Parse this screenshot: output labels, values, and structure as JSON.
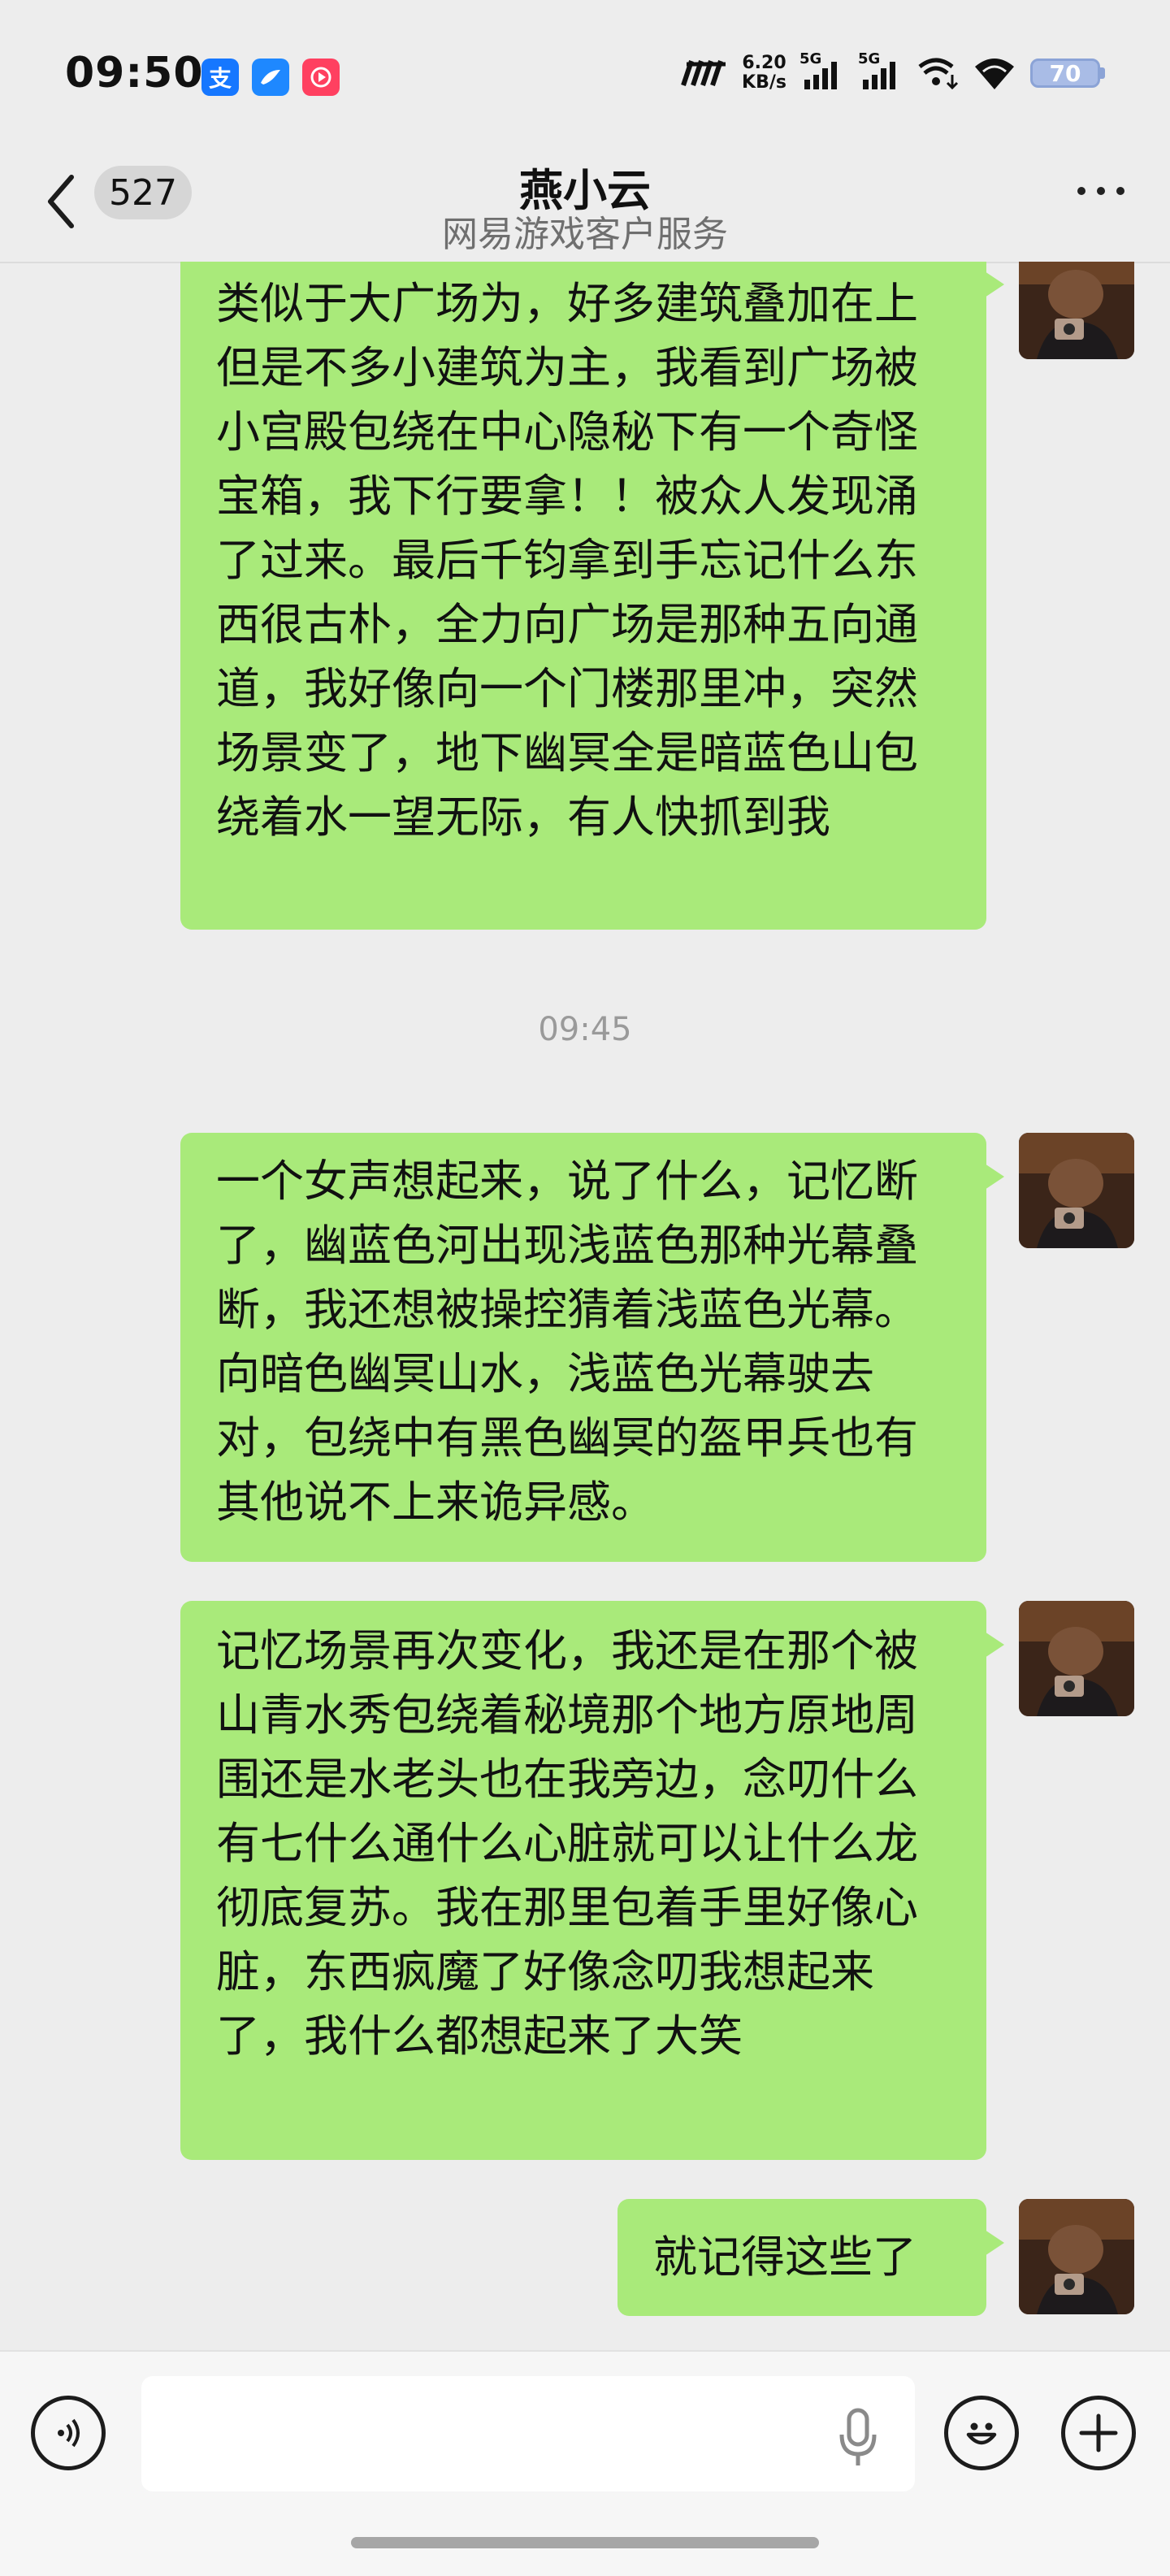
{
  "status_bar": {
    "time": "09:50",
    "net_speed_value": "6.20",
    "net_speed_unit": "KB/s",
    "signal1_label": "5G",
    "signal2_label": "5G",
    "battery_level": "70",
    "app_icons": [
      "alipay-icon",
      "bird-app-icon",
      "video-app-icon"
    ],
    "colors": {
      "alipay": "#1677ff",
      "bird": "#1e88ff",
      "video": "#ff4060"
    }
  },
  "header": {
    "unread_count": "527",
    "title": "燕小云",
    "subtitle": "网易游戏客户服务"
  },
  "messages": [
    {
      "type": "text",
      "from": "me",
      "text": "类似于大广场为，好多建筑叠加在上但是不多小建筑为主，我看到广场被小宫殿包绕在中心隐秘下有一个奇怪宝箱，我下行要拿！！被众人发现涌了过来。最后千钧拿到手忘记什么东西很古朴，全力向广场是那种五向通道，我好像向一个门楼那里冲，突然场景变了，地下幽冥全是暗蓝色山包绕着水一望无际，有人快抓到我"
    },
    {
      "type": "timestamp",
      "text": "09:45"
    },
    {
      "type": "text",
      "from": "me",
      "text": "一个女声想起来，说了什么，记忆断了，幽蓝色河出现浅蓝色那种光幕叠断，我还想被操控猜着浅蓝色光幕。向暗色幽冥山水，浅蓝色光幕驶去对，包绕中有黑色幽冥的盔甲兵也有其他说不上来诡异感。"
    },
    {
      "type": "text",
      "from": "me",
      "text": "记忆场景再次变化，我还是在那个被山青水秀包绕着秘境那个地方原地周围还是水老头也在我旁边，念叨什么有七什么通什么心脏就可以让什么龙彻底复苏。我在那里包着手里好像心脏，东西疯魔了好像念叨我想起来了，我什么都想起来了大笑"
    },
    {
      "type": "text",
      "from": "me",
      "text": "就记得这些了"
    }
  ],
  "input": {
    "placeholder": "",
    "value": ""
  },
  "colors": {
    "background": "#ededed",
    "bubble_mine": "#a9ea7a",
    "timestamp": "#9a9a9a"
  }
}
